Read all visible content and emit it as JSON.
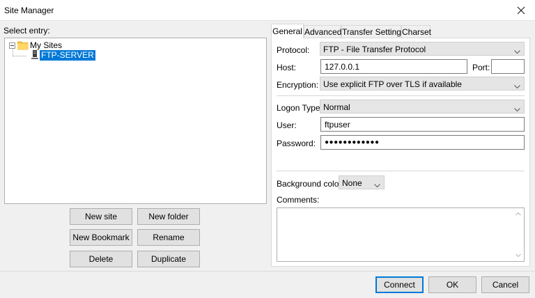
{
  "window": {
    "title": "Site Manager"
  },
  "left": {
    "select_label": "Select entry:",
    "tree": {
      "root": "My Sites",
      "child": "FTP-SERVER"
    },
    "buttons": {
      "new_site": "New site",
      "new_folder": "New folder",
      "new_bookmark": "New Bookmark",
      "rename": "Rename",
      "delete": "Delete",
      "duplicate": "Duplicate"
    }
  },
  "tabs": [
    "General",
    "Advanced",
    "Transfer Settings",
    "Charset"
  ],
  "general": {
    "protocol_label": "Protocol:",
    "protocol_value": "FTP - File Transfer Protocol",
    "host_label": "Host:",
    "host_value": "127.0.0.1",
    "port_label": "Port:",
    "port_value": "",
    "encryption_label": "Encryption:",
    "encryption_value": "Use explicit FTP over TLS if available",
    "logon_type_label": "Logon Type:",
    "logon_type_value": "Normal",
    "user_label": "User:",
    "user_value": "ftpuser",
    "password_label": "Password:",
    "password_value": "●●●●●●●●●●●●",
    "bg_color_label": "Background color:",
    "bg_color_value": "None",
    "comments_label": "Comments:"
  },
  "footer": {
    "connect": "Connect",
    "ok": "OK",
    "cancel": "Cancel"
  },
  "colors": {
    "selection": "#0078d7",
    "folder": "#f4c242"
  }
}
